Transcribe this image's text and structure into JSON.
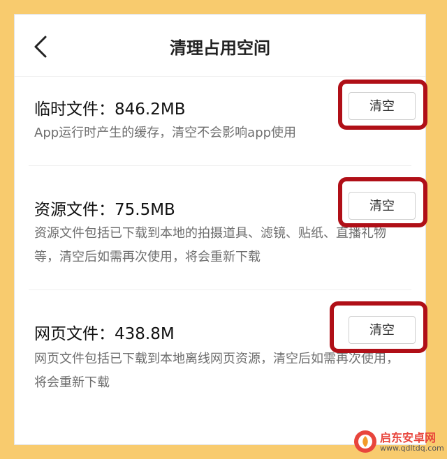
{
  "header": {
    "title": "清理占用空间"
  },
  "sections": [
    {
      "label": "临时文件：846.2MB",
      "description": "App运行时产生的缓存，清空不会影响app使用",
      "button_label": "清空"
    },
    {
      "label": "资源文件：75.5MB",
      "description": "资源文件包括已下载到本地的拍摄道具、滤镜、贴纸、直播礼物等，清空后如需再次使用，将会重新下载",
      "button_label": "清空"
    },
    {
      "label": "网页文件：438.8M",
      "description": "网页文件包括已下载到本地离线网页资源，清空后如需再次使用，将会重新下载",
      "button_label": "清空"
    }
  ],
  "watermark": {
    "name": "启东安卓网",
    "url": "www.qdltdq.com"
  },
  "colors": {
    "background": "#f8cb6e",
    "highlight": "#b00f17",
    "description_text": "#6e6e6e"
  }
}
